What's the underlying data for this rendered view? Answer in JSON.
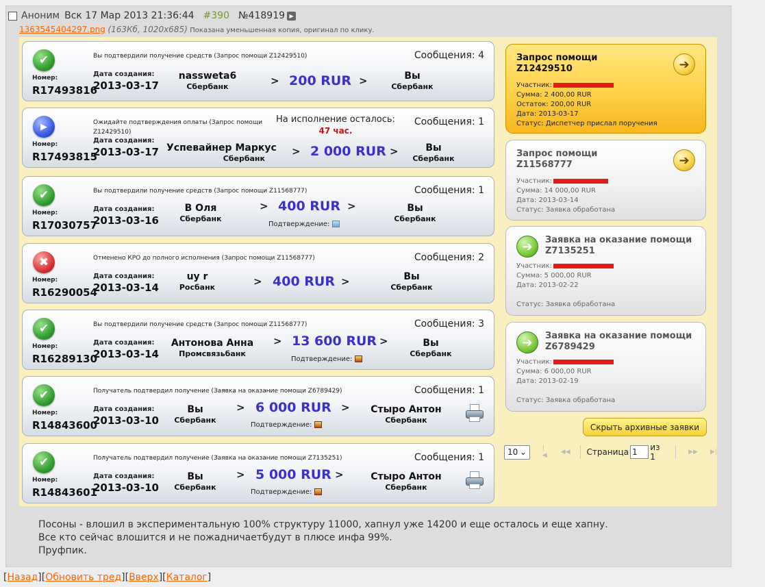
{
  "post": {
    "name": "Аноним",
    "date": "Вск 17 Мар 2013 21:36:44",
    "num": "#390",
    "id": "№418919",
    "file": {
      "name": "1363545404297.png",
      "meta": "(163Кб, 1020x685)",
      "hint": "Показана уменьшенная копия, оригинал по клику."
    },
    "message": [
      "Посоны - влошил в экспериментальную 100% структуру 11000, хапнул уже 14200 и еще осталось и еще хапну.",
      "Все кто сейчас влошится и не пожадничаетбудут в плюсе инфа 99%.",
      "Пруфпик."
    ]
  },
  "labels": {
    "number": "Номер:",
    "created": "Дата создания:",
    "confirm": "Подтверждение:",
    "participant": "Участник:",
    "hide_archive": "Скрыть архивные заявки",
    "page": "Страница",
    "of": "из 1",
    "per_page": "10",
    "page_value": "1"
  },
  "cards": [
    {
      "status": "ok",
      "desc": "Вы подтвердили получение средств (Запрос помощи Z12429510)",
      "messages": "Сообщения: 4",
      "number": "R17493816",
      "date": "2013-03-17",
      "from": "nassweta6",
      "from_bank": "Сбербанк",
      "amount": "200 RUR",
      "to": "Вы",
      "to_bank": "Сбербанк"
    },
    {
      "status": "wait",
      "desc": "Ожидайте подтверждения оплаты (Запрос помощи Z12429510)",
      "messages": "Сообщения: 1",
      "remain_label": "На исполнение осталось:",
      "remain_value": "47 час.",
      "number": "R17493815",
      "date": "2013-03-17",
      "from": "Успевайнер Маркус",
      "from_bank": "Сбербанк",
      "amount": "2 000 RUR",
      "to": "Вы",
      "to_bank": "Сбербанк"
    },
    {
      "status": "ok",
      "desc": "Вы подтвердили получение средств (Запрос помощи Z11568777)",
      "messages": "Сообщения: 1",
      "number": "R17030757",
      "date": "2013-03-16",
      "from": "В Оля",
      "from_bank": "Сбербанк",
      "amount": "400 RUR",
      "to": "Вы",
      "to_bank": "Сбербанк"
    },
    {
      "status": "bad",
      "desc": "Отменено КРО до полного исполнения (Запрос помощи Z11568777)",
      "messages": "Сообщения: 2",
      "number": "R16290054",
      "date": "2013-03-14",
      "from": "uy r",
      "from_bank": "Росбанк",
      "amount": "400 RUR",
      "to": "Вы",
      "to_bank": "Сбербанк"
    },
    {
      "status": "ok",
      "desc": "Вы подтвердили получение средств (Запрос помощи Z11568777)",
      "messages": "Сообщения: 3",
      "number": "R16289130",
      "date": "2013-03-14",
      "from": "Антонова Анна",
      "from_bank": "Промсвязьбанк",
      "amount": "13 600 RUR",
      "to": "Вы",
      "to_bank": "Сбербанк"
    },
    {
      "status": "ok",
      "desc": "Получатель подтвердил получение (Заявка на оказание помощи Z6789429)",
      "messages": "Сообщения: 1",
      "number": "R14843600",
      "date": "2013-03-10",
      "from": "Вы",
      "from_bank": "Сбербанк",
      "amount": "6 000 RUR",
      "to": "Стыро Антон",
      "to_bank": "Сбербанк"
    },
    {
      "status": "ok",
      "desc": "Получатель подтвердил получение (Заявка на оказание помощи Z7135251)",
      "messages": "Сообщения: 1",
      "number": "R14843601",
      "date": "2013-03-10",
      "from": "Вы",
      "from_bank": "Сбербанк",
      "amount": "5 000 RUR",
      "to": "Стыро Антон",
      "to_bank": "Сбербанк"
    }
  ],
  "side": [
    {
      "title1": "Запрос помощи",
      "title2": "Z12429510",
      "lines": [
        "Сумма: 2 400,00 RUR",
        "Остаток: 200,00 RUR",
        "Дата: 2013-03-17",
        "Статус: Диспетчер прислал поручения"
      ]
    },
    {
      "title1": "Запрос помощи",
      "title2": "Z11568777",
      "lines": [
        "Сумма: 14 000,00 RUR",
        "Дата: 2013-03-14",
        "Статус: Заявка обработана"
      ]
    },
    {
      "title1": "Заявка на оказание помощи",
      "title2": "Z7135251",
      "lines": [
        "Сумма: 5 000,00 RUR",
        "Дата: 2013-02-22",
        "Статус: Заявка обработана"
      ]
    },
    {
      "title1": "Заявка на оказание помощи",
      "title2": "Z6789429",
      "lines": [
        "Сумма: 6 000,00 RUR",
        "Дата: 2013-02-19",
        "Статус: Заявка обработана"
      ]
    }
  ],
  "nav": {
    "back": "Назад",
    "refresh": "Обновить тред",
    "up": "Вверх",
    "catalog": "Каталог"
  },
  "icons": {
    "ok": "check-icon",
    "wait": "play-icon",
    "bad": "cross-icon",
    "printer": "printer-icon",
    "confirm": "image-icon"
  },
  "colors": {
    "amount": "#3a2fcf",
    "link": "#ff6600",
    "remain": "#d01010",
    "active_request": "#ffd34d"
  }
}
